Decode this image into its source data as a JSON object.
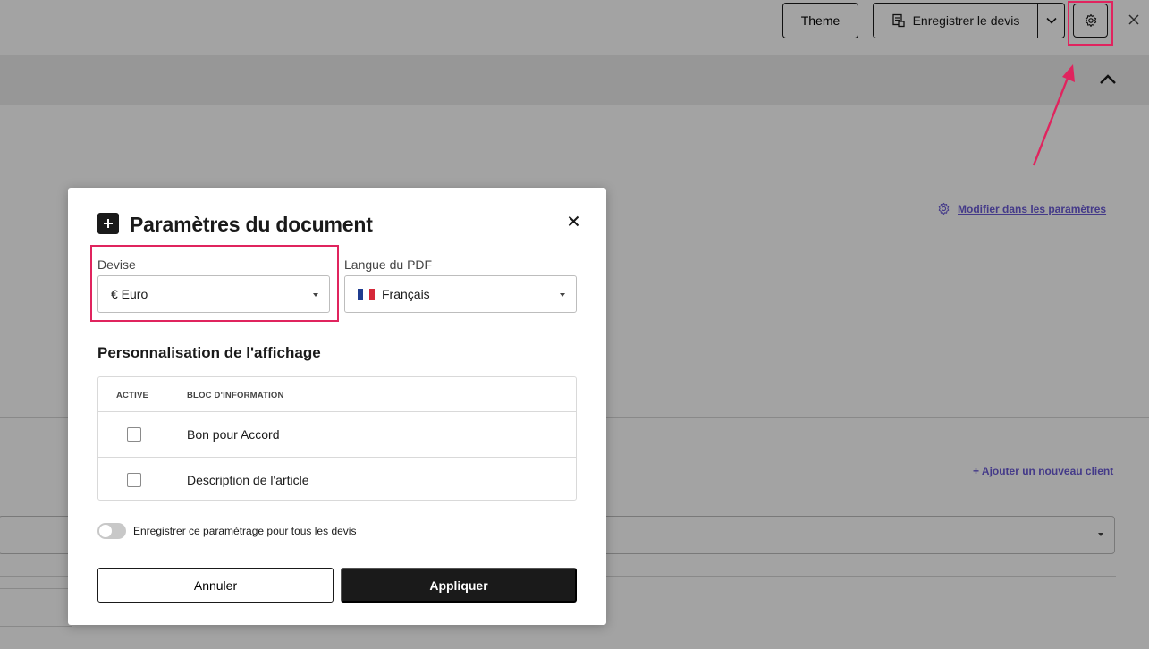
{
  "topbar": {
    "theme_label": "Theme",
    "save_label": "Enregistrer le devis"
  },
  "background": {
    "modify_link": "Modifier dans les paramètres",
    "add_client_link": "+ Ajouter un nouveau client"
  },
  "modal": {
    "title": "Paramètres du document",
    "currency": {
      "label": "Devise",
      "value": "€ Euro"
    },
    "pdf_language": {
      "label": "Langue du PDF",
      "value": "Français"
    },
    "display_section_title": "Personnalisation de l'affichage",
    "table": {
      "headers": [
        "ACTIVE",
        "BLOC D'INFORMATION"
      ],
      "rows": [
        {
          "label": "Bon pour Accord",
          "active": false
        },
        {
          "label": "Description de l'article",
          "active": false
        }
      ]
    },
    "save_setting_label": "Enregistrer ce paramétrage pour tous les devis",
    "save_setting_on": false,
    "cancel_label": "Annuler",
    "apply_label": "Appliquer"
  },
  "colors": {
    "highlight": "#e0245e",
    "link": "#6b5bd6",
    "primary": "#1a1a1a"
  },
  "icons": [
    "save-document-icon",
    "chevron-down-icon",
    "gear-icon",
    "close-icon",
    "chevron-up-icon",
    "plus-icon",
    "france-flag-icon",
    "caret-down-icon"
  ]
}
